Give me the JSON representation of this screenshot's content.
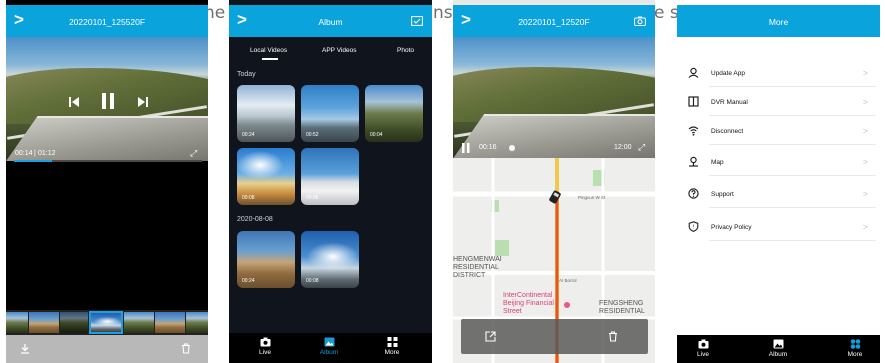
{
  "background_fragments": [
    "ne",
    "ns",
    "e s"
  ],
  "screen1": {
    "title": "20220101_125520F",
    "time_current": "00:14",
    "time_total": "01:12",
    "progress": 0.2,
    "icons": [
      "back-chevron-icon",
      "skip-back-icon",
      "pause-icon",
      "skip-forward-icon",
      "fullscreen-icon",
      "download-icon",
      "trash-icon"
    ]
  },
  "screen2": {
    "title": "Album",
    "tabs": [
      "Local Videos",
      "APP Videos",
      "Photo"
    ],
    "active_tab": "Local Videos",
    "groups": [
      {
        "date": "Today",
        "items": [
          "00:24",
          "00:52",
          "00:04",
          "00:08",
          "00:06"
        ]
      },
      {
        "date": "2020-08-08",
        "items": [
          "00:24",
          "00:08"
        ]
      }
    ],
    "bottom_tabs": [
      {
        "label": "Live",
        "icon": "camera-icon"
      },
      {
        "label": "Album",
        "icon": "gallery-icon",
        "active": true
      },
      {
        "label": "More",
        "icon": "grid-icon"
      }
    ]
  },
  "screen3": {
    "title": "20220101_12520F",
    "time_current": "00:16",
    "time_total": "12:00",
    "map_labels": [
      "Pingcun W St",
      "FENGSHENG RESIDENTIAL",
      "HENGMENWAI RESIDENTIAL DISTRICT",
      "InterContinental Beijing Financial Street",
      "AI Borrol"
    ],
    "icons": [
      "export-icon",
      "trash-icon",
      "camera-icon"
    ]
  },
  "screen4": {
    "title": "More",
    "items": [
      {
        "label": "Update App",
        "icon": "update-icon"
      },
      {
        "label": "DVR Manual",
        "icon": "book-icon"
      },
      {
        "label": "Disconnect",
        "icon": "wifi-icon"
      },
      {
        "label": "Map",
        "icon": "map-pin-icon"
      },
      {
        "label": "Support",
        "icon": "help-icon"
      },
      {
        "label": "Privacy Policy",
        "icon": "shield-icon"
      }
    ],
    "bottom_tabs": [
      {
        "label": "Live",
        "icon": "camera-icon"
      },
      {
        "label": "Album",
        "icon": "gallery-icon"
      },
      {
        "label": "More",
        "icon": "grid-icon",
        "active": true
      }
    ]
  },
  "colors": {
    "topbar": "#0aa3dc",
    "accent": "#1ba1e2",
    "active_tab": "#1a9ad8"
  }
}
